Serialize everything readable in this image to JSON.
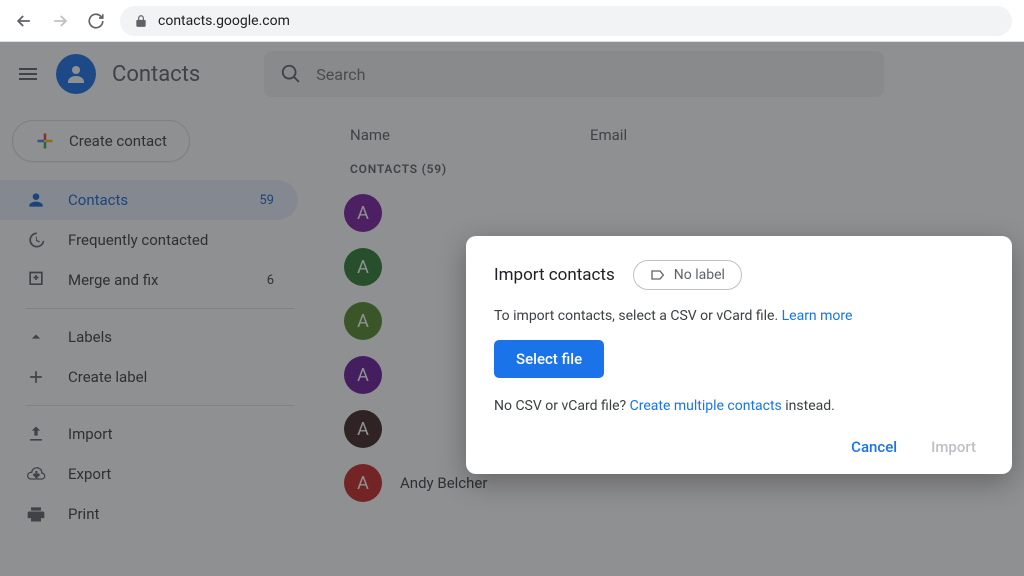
{
  "browser": {
    "url": "contacts.google.com"
  },
  "header": {
    "app_title": "Contacts",
    "search_placeholder": "Search"
  },
  "sidebar": {
    "create_label": "Create contact",
    "items": [
      {
        "label": "Contacts",
        "count": "59"
      },
      {
        "label": "Frequently contacted",
        "count": ""
      },
      {
        "label": "Merge and fix",
        "count": "6"
      }
    ],
    "labels_header": "Labels",
    "create_label_text": "Create label",
    "import_label": "Import",
    "export_label": "Export",
    "print_label": "Print"
  },
  "content": {
    "col_name": "Name",
    "col_email": "Email",
    "section_label": "CONTACTS (59)",
    "rows": [
      {
        "initial": "A",
        "color": "#7b1fa2",
        "name": ""
      },
      {
        "initial": "A",
        "color": "#2e7d32",
        "name": ""
      },
      {
        "initial": "A",
        "color": "#558b2f",
        "name": ""
      },
      {
        "initial": "A",
        "color": "#6a1b9a",
        "name": ""
      },
      {
        "initial": "A",
        "color": "#3e2723",
        "name": ""
      },
      {
        "initial": "A",
        "color": "#c62828",
        "name": "Andy Belcher"
      }
    ]
  },
  "dialog": {
    "title": "Import contacts",
    "label_chip": "No label",
    "body_text": "To import contacts, select a CSV or vCard file. ",
    "learn_more": "Learn more",
    "select_file": "Select file",
    "sub_prefix": "No CSV or vCard file? ",
    "sub_link": "Create multiple contacts",
    "sub_suffix": " instead.",
    "cancel": "Cancel",
    "import": "Import"
  }
}
